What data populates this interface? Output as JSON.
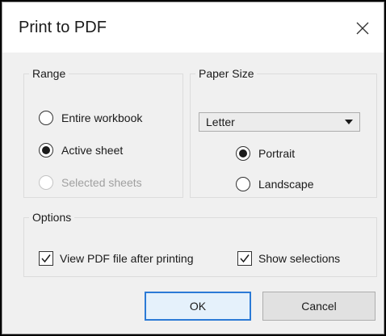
{
  "dialog": {
    "title": "Print to PDF"
  },
  "range": {
    "legend": "Range",
    "options": [
      {
        "label": "Entire workbook",
        "selected": false,
        "enabled": true
      },
      {
        "label": "Active sheet",
        "selected": true,
        "enabled": true
      },
      {
        "label": "Selected sheets",
        "selected": false,
        "enabled": false
      }
    ]
  },
  "paper_size": {
    "legend": "Paper Size",
    "selected": "Letter",
    "orientation": [
      {
        "label": "Portrait",
        "selected": true
      },
      {
        "label": "Landscape",
        "selected": false
      }
    ]
  },
  "options": {
    "legend": "Options",
    "view_pdf": {
      "label": "View PDF file after printing",
      "checked": true
    },
    "show_selections": {
      "label": "Show selections",
      "checked": true
    }
  },
  "buttons": {
    "ok": "OK",
    "cancel": "Cancel"
  },
  "colors": {
    "dialog_bg": "#f0f0f0",
    "title_bg": "#ffffff",
    "ok_border": "#2b7ad6",
    "disabled_text": "#a0a0a0"
  }
}
